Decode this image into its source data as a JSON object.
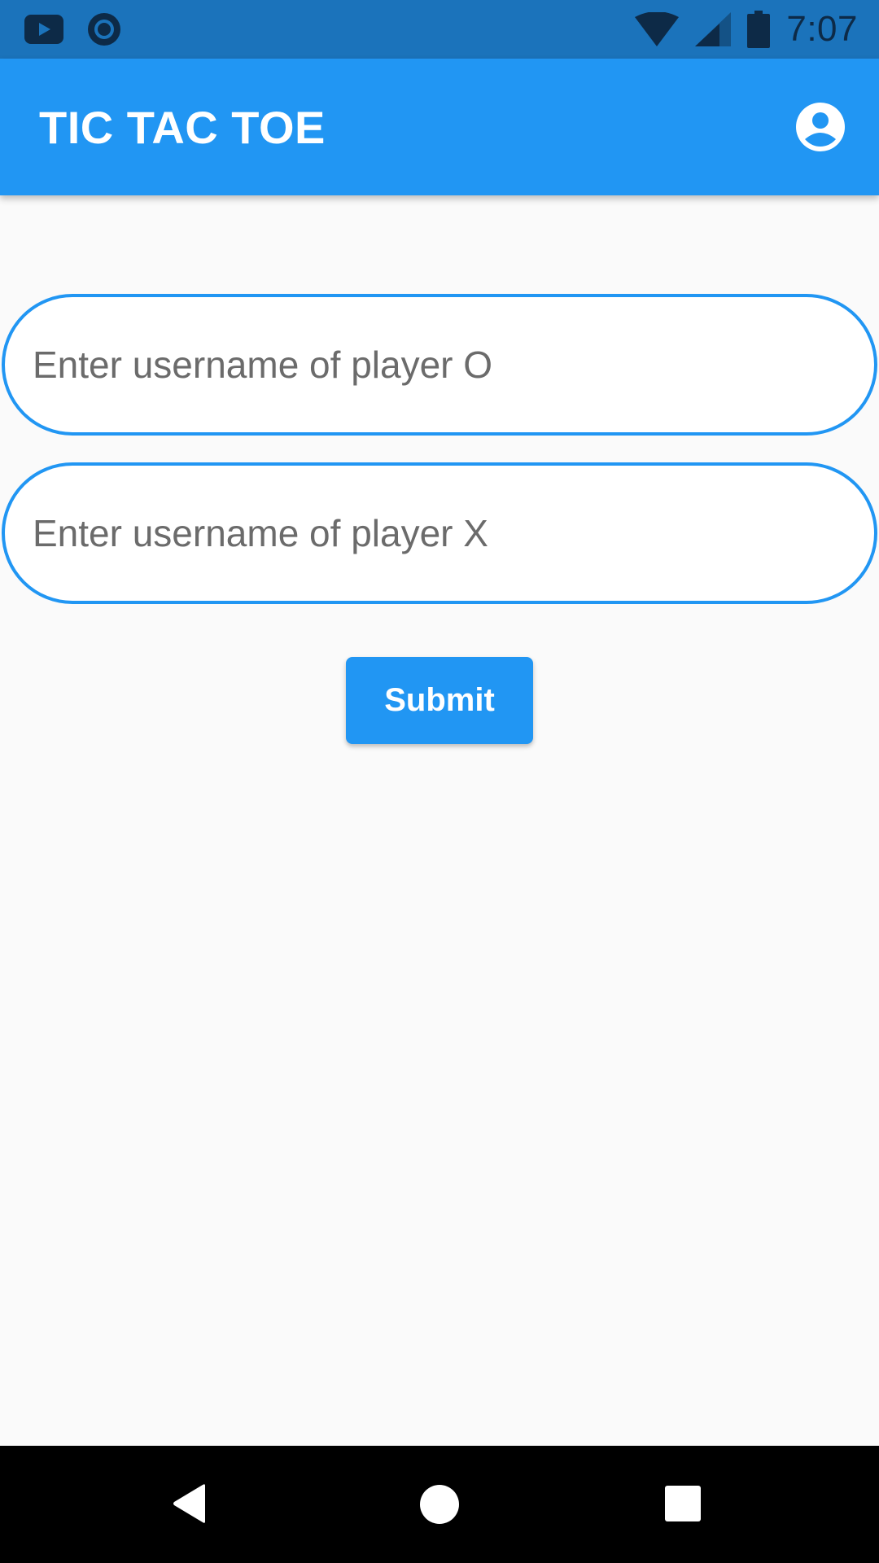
{
  "status_bar": {
    "time": "7:07",
    "icons": [
      "youtube-icon",
      "record-icon",
      "wifi-icon",
      "signal-icon",
      "battery-icon"
    ]
  },
  "app_bar": {
    "title": "TIC TAC TOE",
    "action_icon": "account-circle-icon"
  },
  "form": {
    "player_o": {
      "placeholder": "Enter username of player O",
      "value": ""
    },
    "player_x": {
      "placeholder": "Enter username of player X",
      "value": ""
    },
    "submit_label": "Submit"
  },
  "nav_bar": {
    "icons": [
      "back-icon",
      "home-icon",
      "recents-icon"
    ]
  },
  "colors": {
    "primary": "#2196f3",
    "status_bar": "#1b73bb",
    "background": "#fafafa",
    "nav_bar": "#000000"
  }
}
